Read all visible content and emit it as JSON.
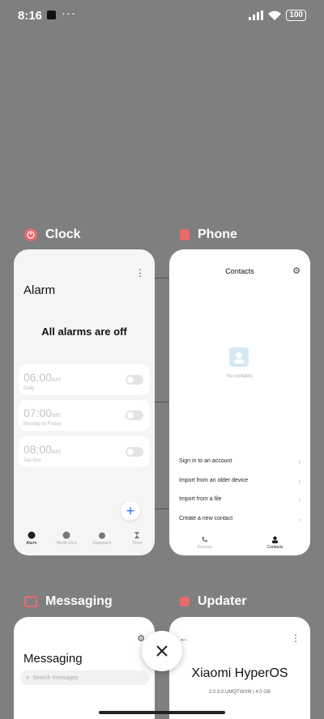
{
  "status_bar": {
    "time": "8:16",
    "dots": "···",
    "battery": "100"
  },
  "apps": {
    "clock": {
      "name": "Clock",
      "alarm_title": "Alarm",
      "alarms_off": "All alarms are off",
      "alarms": [
        {
          "time": "06:00",
          "ampm": "am",
          "repeat": "Daily"
        },
        {
          "time": "07:00",
          "ampm": "am",
          "repeat": "Monday to Friday"
        },
        {
          "time": "08:00",
          "ampm": "am",
          "repeat": "Sat-Sun"
        }
      ],
      "nav": [
        "Alarm",
        "World clock",
        "Stopwatch",
        "Timer"
      ]
    },
    "phone": {
      "name": "Phone",
      "title": "Contacts",
      "empty": "No contacts",
      "options": [
        "Sign in to an account",
        "Import from an older device",
        "Import from a file",
        "Create a new contact"
      ],
      "nav": [
        "Recents",
        "Contacts"
      ]
    },
    "messaging": {
      "name": "Messaging",
      "title": "Messaging",
      "search_placeholder": "Search messages"
    },
    "updater": {
      "name": "Updater",
      "brand": "Xiaomi HyperOS",
      "version": "2.0.3.0.UMQTWXM | 4.0 GB"
    }
  },
  "colors": {
    "accent": "#2b6fff",
    "backdrop": "#7f7f7f"
  }
}
